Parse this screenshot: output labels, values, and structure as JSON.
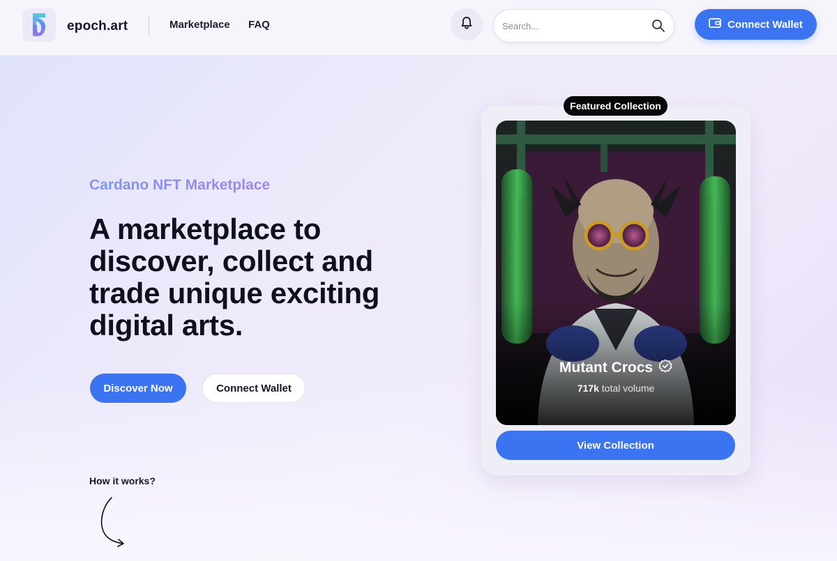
{
  "header": {
    "brand": "epoch.art",
    "nav": [
      {
        "label": "Marketplace"
      },
      {
        "label": "FAQ"
      }
    ],
    "search": {
      "placeholder": "Search..."
    },
    "connect_wallet_label": "Connect Wallet",
    "icons": {
      "logo": "epoch-logo-icon",
      "notifications": "bell-icon",
      "search": "search-icon",
      "wallet": "wallet-icon"
    }
  },
  "hero": {
    "eyebrow": "Cardano NFT Marketplace",
    "title": "A marketplace to discover, collect and trade unique exciting digital arts.",
    "primary_button": "Discover Now",
    "secondary_button": "Connect Wallet",
    "how_it_works": "How it works?"
  },
  "featured": {
    "badge": "Featured Collection",
    "collection_name": "Mutant Crocs",
    "verified": true,
    "volume_value": "717k",
    "volume_suffix": "total volume",
    "view_button": "View Collection"
  },
  "colors": {
    "accent": "#3b74f0",
    "eyebrow_gradient_start": "#7d97ef",
    "eyebrow_gradient_end": "#a583ec",
    "badge_bg": "#080808"
  }
}
